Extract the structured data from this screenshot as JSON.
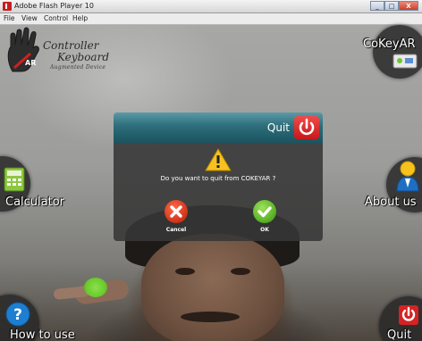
{
  "window": {
    "title": "Adobe Flash Player 10",
    "controls": {
      "minimize": "_",
      "maximize": "□",
      "close": "X"
    }
  },
  "menu": [
    "File",
    "View",
    "Control",
    "Help"
  ],
  "logo": {
    "line1": "Controller",
    "line2": "Keyboard",
    "line3": "Augmented Device",
    "mark": "AR"
  },
  "buttons": {
    "app": "CoKeyAR",
    "calculator": "Calculator",
    "about": "About us",
    "howto": "How to use",
    "quit": "Quit"
  },
  "dialog": {
    "title": "Quit",
    "message": "Do you want to quit from COKEYAR ?",
    "cancel": "Cancel",
    "ok": "OK"
  },
  "colors": {
    "dialog_header": "#2d6d7a",
    "power_red": "#d42323",
    "cancel_red": "#d63a1e",
    "ok_green": "#5fb52a",
    "info_blue": "#1e7fd0"
  },
  "icons": {
    "app_icon": "flash-player-icon",
    "calculator": "calculator-icon",
    "about": "person-icon",
    "howto": "question-icon",
    "quit": "power-icon",
    "warning": "warning-icon"
  }
}
